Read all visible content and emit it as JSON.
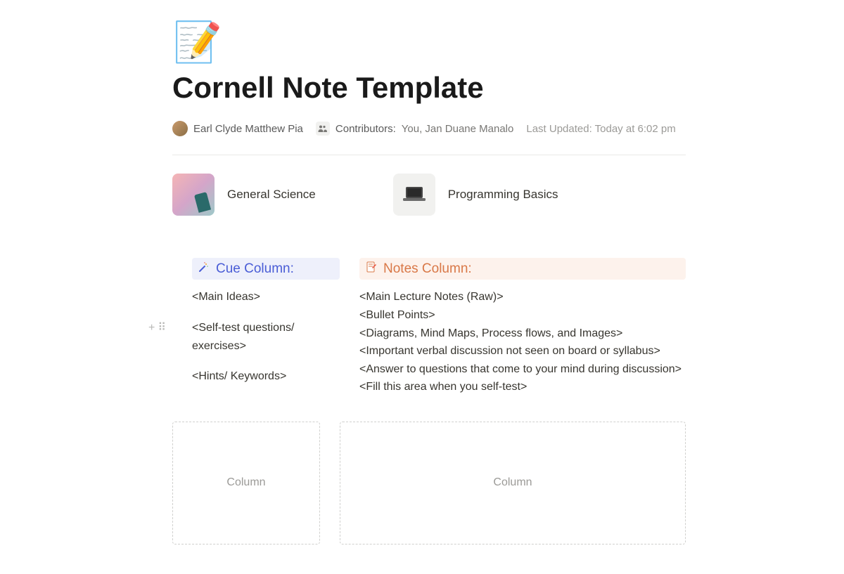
{
  "page": {
    "icon_emoji": "📝",
    "title": "Cornell Note Template"
  },
  "meta": {
    "author": "Earl Clyde Matthew Pia",
    "contributors_label": "Contributors:",
    "contributors_names": "You, Jan Duane Manalo",
    "last_updated": "Last Updated: Today at 6:02 pm"
  },
  "subjects": [
    {
      "title": "General Science",
      "icon": "science"
    },
    {
      "title": "Programming Basics",
      "icon": "laptop"
    }
  ],
  "columns": {
    "cue": {
      "header": "Cue Column:",
      "lines": [
        "<Main Ideas>",
        "",
        "<Self-test questions/ exercises>",
        "",
        "<Hints/ Keywords>"
      ]
    },
    "notes": {
      "header": "Notes Column:",
      "lines": [
        "<Main Lecture Notes (Raw)>",
        "<Bullet Points>",
        "<Diagrams, Mind Maps, Process flows, and Images>",
        "<Important verbal discussion not seen on board or syllabus>",
        "<Answer to questions that come to your mind during discussion>",
        "<Fill this area when you self-test>"
      ]
    }
  },
  "placeholders": {
    "cue": "Column",
    "notes": "Column"
  }
}
